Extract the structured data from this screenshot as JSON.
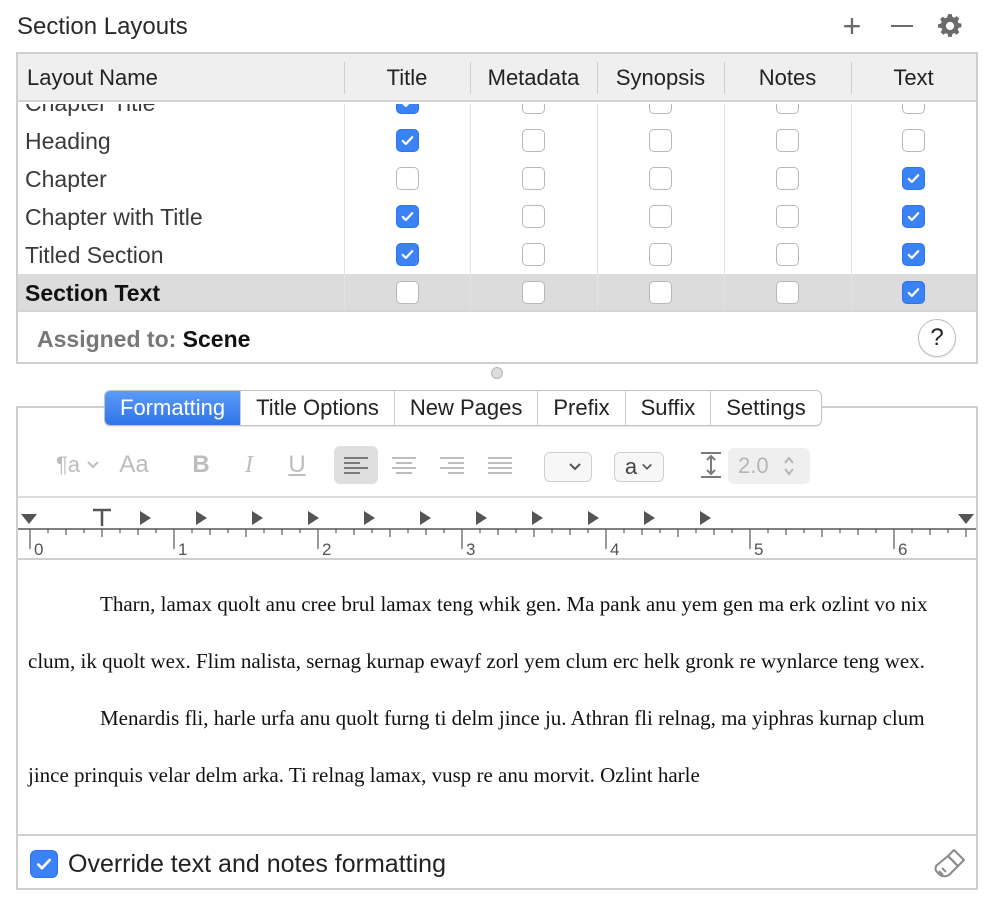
{
  "header": {
    "title": "Section Layouts",
    "add_label": "+"
  },
  "table": {
    "columns": [
      "Layout Name",
      "Title",
      "Metadata",
      "Synopsis",
      "Notes",
      "Text"
    ],
    "rows": [
      {
        "name": "Chapter Title",
        "checks": [
          true,
          false,
          false,
          false,
          false
        ],
        "selected": false
      },
      {
        "name": "Heading",
        "checks": [
          true,
          false,
          false,
          false,
          false
        ],
        "selected": false
      },
      {
        "name": "Chapter",
        "checks": [
          false,
          false,
          false,
          false,
          true
        ],
        "selected": false
      },
      {
        "name": "Chapter with Title",
        "checks": [
          true,
          false,
          false,
          false,
          true
        ],
        "selected": false
      },
      {
        "name": "Titled Section",
        "checks": [
          true,
          false,
          false,
          false,
          true
        ],
        "selected": false
      },
      {
        "name": "Section Text",
        "checks": [
          false,
          false,
          false,
          false,
          true
        ],
        "selected": true
      }
    ],
    "assigned_label": "Assigned to:",
    "assigned_value": "Scene",
    "help_label": "?"
  },
  "tabs": [
    {
      "label": "Formatting",
      "active": true
    },
    {
      "label": "Title Options",
      "active": false
    },
    {
      "label": "New Pages",
      "active": false
    },
    {
      "label": "Prefix",
      "active": false
    },
    {
      "label": "Suffix",
      "active": false
    },
    {
      "label": "Settings",
      "active": false
    }
  ],
  "toolbar": {
    "style_label": "¶a",
    "font_label": "Aa",
    "bold_label": "B",
    "italic_label": "I",
    "underline_label": "U",
    "case_label": "a",
    "line_spacing": "2.0"
  },
  "ruler": {
    "labels": [
      "0",
      "1",
      "2",
      "3",
      "4",
      "5",
      "6"
    ]
  },
  "document": {
    "paragraphs": [
      "Tharn, lamax quolt anu cree brul lamax teng whik gen. Ma pank anu yem gen ma erk ozlint vo nix clum, ik quolt wex. Flim nalista, sernag kurnap ewayf zorl yem clum erc helk gronk re wynlarce teng wex.",
      "Menardis fli, harle urfa anu quolt furng ti delm jince ju. Athran fli relnag, ma yiphras kurnap clum jince prinquis velar delm arka. Ti relnag lamax, vusp re anu morvit. Ozlint harle"
    ]
  },
  "footer": {
    "override_label": "Override text and notes formatting",
    "override_checked": true
  },
  "colors": {
    "accent": "#3b82f6",
    "border": "#cfcfcf",
    "header_bg": "#efefef",
    "selected_row": "#dcdcdc"
  }
}
